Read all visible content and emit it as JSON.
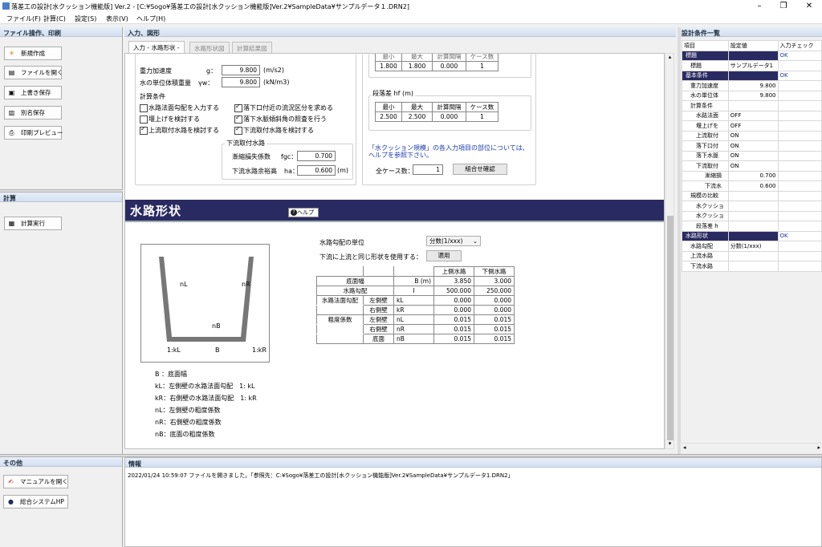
{
  "window": {
    "title": "落差工の設計[水クッション機能版] Ver.2 - [C:¥Sogo¥落差工の設計[水クッション機能版]Ver.2¥SampleData¥サンプルデータ１.DRN2]"
  },
  "menu": [
    "ファイル(F)",
    "計算(C)",
    "設定(S)",
    "表示(V)",
    "ヘルプ(H)"
  ],
  "left": {
    "file_header": "ファイル操作、印刷",
    "file_buttons": [
      "新規作成",
      "ファイルを開く",
      "上書き保存",
      "別名保存",
      "印刷プレビュー"
    ],
    "calc_header": "計算",
    "calc_button": "計算実行",
    "other_header": "その他",
    "other_buttons": [
      "マニュアルを開く",
      "総合システムHP"
    ]
  },
  "main": {
    "header": "入力、図形",
    "tabs": [
      "入力 - 水路形状 -",
      "水路形状図",
      "計算結果図"
    ],
    "gravity_label": "重力加速度",
    "gravity_sym": "g：",
    "gravity_value": "9.800",
    "gravity_unit": "(m/s2)",
    "water_label": "水の単位体積重量",
    "water_sym": "γw：",
    "water_value": "9.800",
    "water_unit": "(kN/m3)",
    "calc_cond_label": "計算条件",
    "checkboxes": [
      {
        "label": "水路法面勾配を入力する",
        "checked": false
      },
      {
        "label": "落下口付近の流況区分を求める",
        "checked": true
      },
      {
        "label": "堰上げを検討する",
        "checked": false
      },
      {
        "label": "落下水脈傾斜角の照査を行う",
        "checked": true
      },
      {
        "label": "上流取付水路を検討する",
        "checked": true
      },
      {
        "label": "下流取付水路を検討する",
        "checked": true
      }
    ],
    "downstream_group": "下流取付水路",
    "loss_label": "漸縮損失係数",
    "loss_sym": "fgc：",
    "loss_value": "0.700",
    "margin_label": "下流水路余裕高",
    "margin_sym": "ha：",
    "margin_value": "0.600",
    "margin_unit": "(m)",
    "top_table": {
      "headers": [
        "最小",
        "最大",
        "計算間隔",
        "ケース数"
      ],
      "row": [
        "1.800",
        "1.800",
        "0.000",
        "1"
      ]
    },
    "drop_label": "段落差 hf (m)",
    "drop_table": {
      "headers": [
        "最小",
        "最大",
        "計算間隔",
        "ケース数"
      ],
      "row": [
        "2.500",
        "2.500",
        "0.000",
        "1"
      ]
    },
    "note_line1": "「水クッション規模」の各入力項目の部位については、",
    "note_line2": "ヘルプを参照下さい。",
    "total_cases_label": "全ケース数：",
    "total_cases_value": "1",
    "combo_button": "組合せ確認",
    "section_title": "水路形状",
    "help_button": "ヘルプ",
    "slope_unit_label": "水路勾配の単位",
    "slope_unit_value": "分数(1/xxx)",
    "same_shape_label": "下流に上流と同じ形状を使用する：",
    "apply_button": "適用",
    "shape_table": {
      "headers": [
        "",
        "",
        "",
        "上側水路",
        "下側水路"
      ],
      "rows": [
        [
          "底面幅",
          "",
          "B (m)",
          "3.850",
          "3.000"
        ],
        [
          "水路勾配",
          "",
          "I",
          "500.000",
          "250.000"
        ],
        [
          "水路法面勾配",
          "左側壁",
          "kL",
          "0.000",
          "0.000"
        ],
        [
          "",
          "右側壁",
          "kR",
          "0.000",
          "0.000"
        ],
        [
          "粗度係数",
          "左側壁",
          "nL",
          "0.015",
          "0.015"
        ],
        [
          "",
          "右側壁",
          "nR",
          "0.015",
          "0.015"
        ],
        [
          "",
          "底面",
          "nB",
          "0.015",
          "0.015"
        ]
      ]
    },
    "diagram_labels": {
      "nL": "nL",
      "nR": "nR",
      "nB": "nB",
      "kL": "1:kL",
      "B": "B",
      "kR": "1:kR"
    },
    "legend": [
      "B ：底面幅",
      "kL：左側壁の水路法面勾配　1: kL",
      "kR：右側壁の水路法面勾配　1: kR",
      "nL：左側壁の粗度係数",
      "nR：右側壁の粗度係数",
      "nB：底面の粗度係数"
    ]
  },
  "info": {
    "header": "情報",
    "message": "2022/01/24 10:59:07 ファイルを開きました。「参照先：C:¥Sogo¥落差工の設計[水クッション機能版]Ver.2¥SampleData¥サンプルデータ1.DRN2」"
  },
  "right": {
    "header": "設計条件一覧",
    "columns": [
      "項目",
      "設定値",
      "入力チェック"
    ],
    "rows": [
      {
        "item": "標題",
        "value": "",
        "check": "OK",
        "type": "sec"
      },
      {
        "item": "標題",
        "value": "サンプルデータ1",
        "check": "",
        "type": "r1"
      },
      {
        "item": "基本条件",
        "value": "",
        "check": "OK",
        "type": "sec"
      },
      {
        "item": "重力加速度",
        "value": "9.800",
        "check": "",
        "type": "r1"
      },
      {
        "item": "水の単位体",
        "value": "9.800",
        "check": "",
        "type": "r1"
      },
      {
        "item": "計算条件",
        "value": "",
        "check": "",
        "type": "r1"
      },
      {
        "item": "水路法面",
        "value": "OFF",
        "check": "",
        "type": "r2"
      },
      {
        "item": "堰上げを",
        "value": "OFF",
        "check": "",
        "type": "r2"
      },
      {
        "item": "上流取付",
        "value": "ON",
        "check": "",
        "type": "r2"
      },
      {
        "item": "落下口付",
        "value": "ON",
        "check": "",
        "type": "r2"
      },
      {
        "item": "落下水脈",
        "value": "ON",
        "check": "",
        "type": "r2"
      },
      {
        "item": "下流取付",
        "value": "ON",
        "check": "",
        "type": "r2"
      },
      {
        "item": "漸縮損",
        "value": "0.700",
        "check": "",
        "type": "r3"
      },
      {
        "item": "下流水",
        "value": "0.600",
        "check": "",
        "type": "r3"
      },
      {
        "item": "規模の比較",
        "value": "",
        "check": "",
        "type": "r1"
      },
      {
        "item": "水クッショ",
        "value": "",
        "check": "",
        "type": "r2"
      },
      {
        "item": "水クッショ",
        "value": "",
        "check": "",
        "type": "r2"
      },
      {
        "item": "段落差 h",
        "value": "",
        "check": "",
        "type": "r2"
      },
      {
        "item": "水路形状",
        "value": "",
        "check": "OK",
        "type": "sec"
      },
      {
        "item": "水路勾配",
        "value": "分数(1/xxx)",
        "check": "",
        "type": "r1"
      },
      {
        "item": "上流水路",
        "value": "",
        "check": "",
        "type": "r1"
      },
      {
        "item": "下流水路",
        "value": "",
        "check": "",
        "type": "r1"
      }
    ]
  }
}
